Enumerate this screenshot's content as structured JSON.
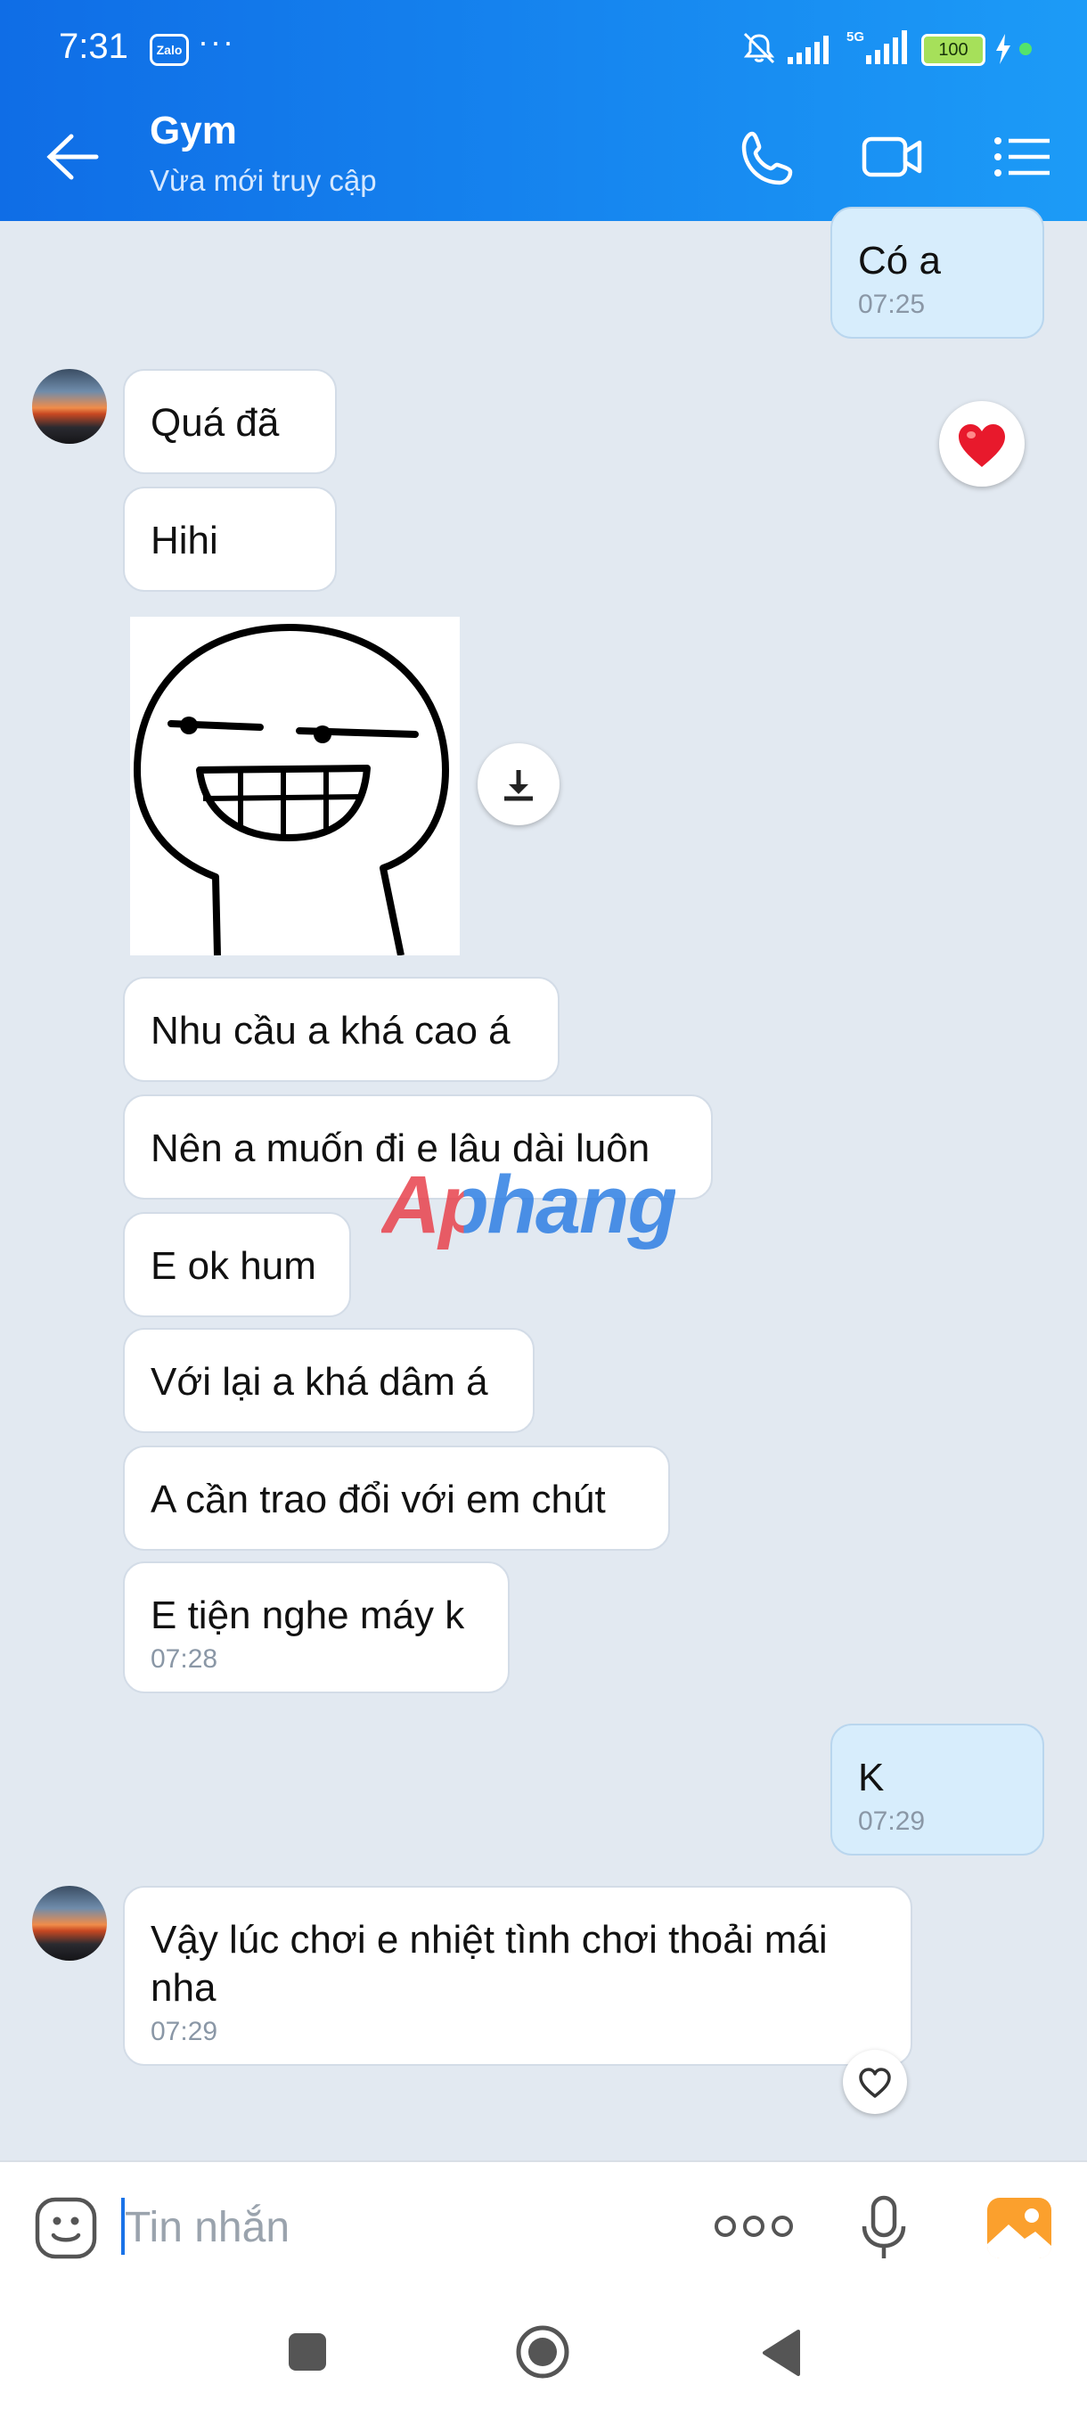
{
  "status_bar": {
    "time": "7:31",
    "app_badge": "Zalo",
    "dots": "···",
    "battery": "100"
  },
  "header": {
    "title": "Gym",
    "subtitle": "Vừa mới truy cập"
  },
  "messages": [
    {
      "text": "Có a",
      "time": "07:25",
      "sender": "me"
    },
    {
      "text": "Quá đã",
      "sender": "them"
    },
    {
      "text": "Hihi",
      "sender": "them"
    },
    {
      "text": "Nhu cầu a khá cao á",
      "sender": "them"
    },
    {
      "text": "Nên a muốn đi e lâu dài luôn",
      "sender": "them"
    },
    {
      "text": "E ok hum",
      "sender": "them"
    },
    {
      "text": "Với lại a khá dâm á",
      "sender": "them"
    },
    {
      "text": "A cần trao đổi với em chút",
      "sender": "them"
    },
    {
      "text": "E tiện nghe máy k",
      "time": "07:28",
      "sender": "them"
    },
    {
      "text": "K",
      "time": "07:29",
      "sender": "me"
    },
    {
      "text": "Vậy lúc chơi e nhiệt tình chơi thoải mái nha",
      "time": "07:29",
      "sender": "them"
    }
  ],
  "watermark": "Aphang",
  "input": {
    "placeholder": "Tin nhắn"
  },
  "icons": {
    "reaction": "heart-icon",
    "download": "download-icon",
    "emoji": "emoji-icon",
    "more": "more-icon",
    "mic": "mic-icon",
    "gallery": "image-icon"
  },
  "colors": {
    "header_start": "#0f6de6",
    "header_end": "#1c9bf7",
    "my_bubble": "#d7edfc",
    "chat_bg": "#e2e9f1"
  }
}
